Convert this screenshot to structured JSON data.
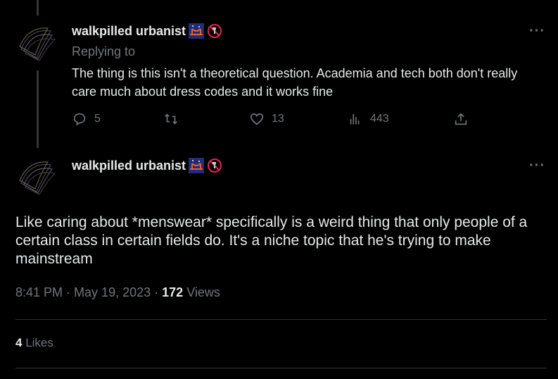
{
  "reply_tweet": {
    "author_name": "walkpilled urbanist",
    "badges": [
      "bridge-night-emoji",
      "no-drinking-water-emoji"
    ],
    "replying_to_label": "Replying to",
    "text": "The thing is this isn't a theoretical question. Academia and tech both don't really care much about dress codes and it works fine",
    "actions": {
      "reply_count": "5",
      "retweet_count": "",
      "like_count": "13",
      "view_count": "443"
    }
  },
  "main_tweet": {
    "author_name": "walkpilled urbanist",
    "badges": [
      "bridge-night-emoji",
      "no-drinking-water-emoji"
    ],
    "text": "Like caring about *menswear* specifically is a weird thing that only people of a certain class in certain fields do. It's a niche topic that he's trying to make mainstream",
    "time": "8:41 PM",
    "sep1": " · ",
    "date": "May 19, 2023",
    "sep2": " · ",
    "views_count": "172",
    "views_label": "Views",
    "likes_count": "4",
    "likes_label": "Likes"
  },
  "colors": {
    "background": "#000000",
    "text_primary": "#e7e9ea",
    "text_secondary": "#71767b",
    "divider": "#2f3336"
  }
}
